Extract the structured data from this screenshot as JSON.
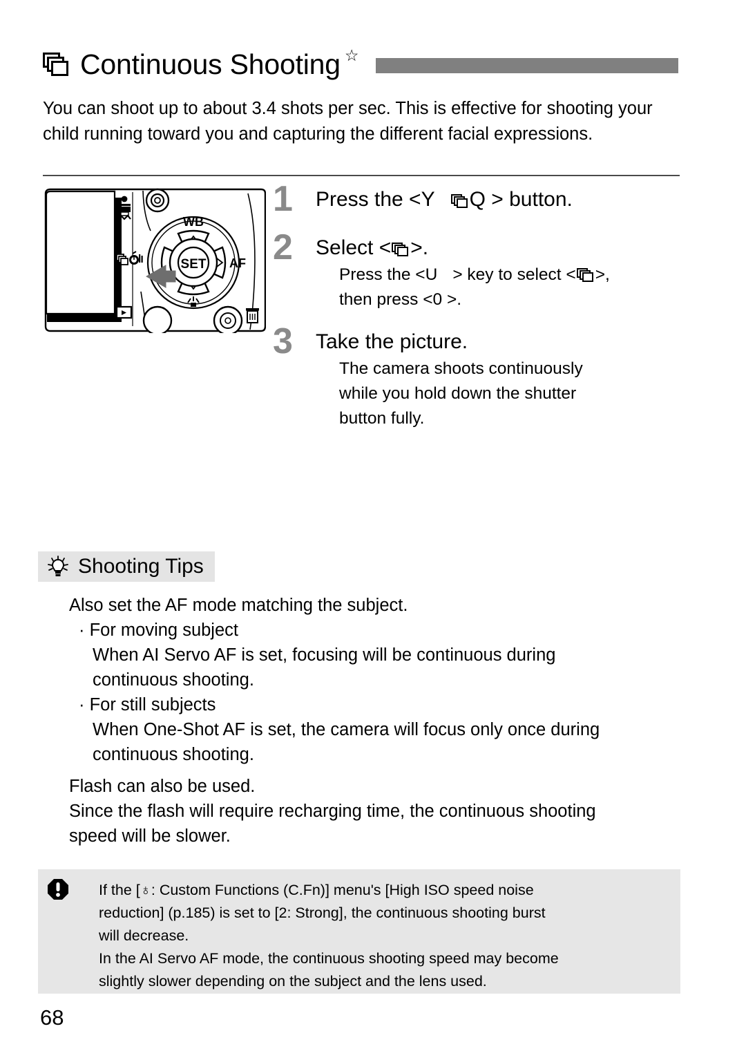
{
  "title": {
    "icon": "continuous-drive-icon",
    "text": "Continuous Shooting",
    "star": "☆"
  },
  "intro": "You can shoot up to about 3.4 shots per sec. This is effective for shooting your child running toward you and capturing the different facial expressions.",
  "steps": [
    {
      "num": "1",
      "title_pre": "Press the <Y",
      "title_post": "Q  > button.",
      "body": []
    },
    {
      "num": "2",
      "title_pre": "Select <",
      "title_post": ">.",
      "body": [
        {
          "pre": "Press the <U",
          "mid": "> key to select <",
          "post": ">,"
        },
        {
          "pre": "then press <0   >.",
          "mid": "",
          "post": ""
        }
      ]
    },
    {
      "num": "3",
      "title_pre": "Take the picture.",
      "title_post": "",
      "body": [
        {
          "pre": "The camera shoots continuously",
          "mid": "",
          "post": ""
        },
        {
          "pre": "while you hold down the shutter",
          "mid": "",
          "post": ""
        },
        {
          "pre": "button fully.",
          "mid": "",
          "post": ""
        }
      ]
    }
  ],
  "tips": {
    "icon": "lightbulb-icon",
    "header": "Shooting Tips",
    "lines": [
      {
        "indent": 0,
        "text": "Also set the AF mode matching the subject."
      },
      {
        "indent": 1,
        "text": "· For moving subject"
      },
      {
        "indent": 2,
        "text": "When AI Servo AF is set, focusing will be continuous during"
      },
      {
        "indent": 2,
        "text": "continuous shooting."
      },
      {
        "indent": 1,
        "text": "· For still subjects"
      },
      {
        "indent": 2,
        "text": "When One-Shot AF is set, the camera will focus only once during"
      },
      {
        "indent": 2,
        "text": "continuous shooting."
      },
      {
        "indent": 0,
        "text": "Flash can also be used."
      },
      {
        "indent": 0,
        "text": "Since the flash will require recharging time, the continuous shooting"
      },
      {
        "indent": 0,
        "text": "speed will be slower."
      }
    ]
  },
  "caution": {
    "icon": "warning-icon",
    "lines": [
      "If the [♁: Custom Functions (C.Fn)] menu's [High ISO speed noise",
      "reduction] (p.185) is set to [2: Strong], the continuous shooting burst",
      "will decrease.",
      "In the AI Servo AF mode, the continuous shooting speed may become",
      "slightly slower depending on the subject and the lens used."
    ]
  },
  "camera_diagram": {
    "lcd_label": "lcd-screen",
    "buttons": {
      "wb": "WB",
      "af": "AF",
      "set": "SET",
      "playback": "▶"
    },
    "side_icons": [
      "print-share-icon",
      "drive-mode-icon",
      "playback-icon"
    ],
    "indicators": [
      "trash-icon",
      "flash-icon"
    ]
  },
  "page_number": "68",
  "colors": {
    "title_bar": "#808080",
    "step_number": "#8a8a8a",
    "tips_header_bg": "#e4e4e4",
    "caution_bg": "#e6e6e6",
    "rule": "#4a4a4a"
  }
}
